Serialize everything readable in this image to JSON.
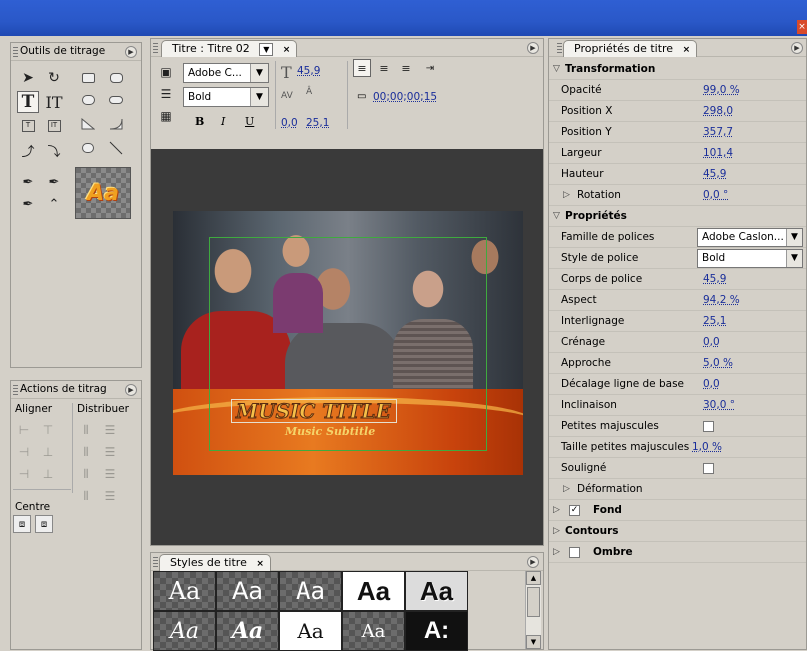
{
  "window": {
    "close_glyph": "×"
  },
  "tools_panel": {
    "title": "Outils de titrage",
    "sample_text": "Aa"
  },
  "actions_panel": {
    "title": "Actions de titrag",
    "align_label": "Aligner",
    "distribute_label": "Distribuer",
    "center_label": "Centre"
  },
  "title_panel": {
    "tab_label": "Titre : Titre 02",
    "font_family": "Adobe C...",
    "font_style": "Bold",
    "font_size": "45,9",
    "kerning": "0,0",
    "leading": "25,1",
    "timecode": "00;00;00;15",
    "bold_label": "B",
    "italic_label": "I",
    "underline_label": "U",
    "music_title": "MUSIC TITLE",
    "music_subtitle": "Music Subtitle"
  },
  "styles_panel": {
    "tab_label": "Styles de titre",
    "swatches": [
      "Aa",
      "Aa",
      "Aa",
      "Aa",
      "Aa",
      "Aa",
      "Aa",
      "Aa",
      "Aa",
      "A:"
    ]
  },
  "properties_panel": {
    "tab_label": "Propriétés de titre",
    "transformation_label": "Transformation",
    "opacity_label": "Opacité",
    "opacity": "99,0 %",
    "pos_x_label": "Position X",
    "pos_x": "298,0",
    "pos_y_label": "Position Y",
    "pos_y": "357,7",
    "width_label": "Largeur",
    "width": "101,4",
    "height_label": "Hauteur",
    "height": "45,9",
    "rotation_label": "Rotation",
    "rotation": "0,0 °",
    "properties_label": "Propriétés",
    "font_family_label": "Famille de polices",
    "font_family": "Adobe Caslon...",
    "font_style_label": "Style de police",
    "font_style": "Bold",
    "font_size_label": "Corps de police",
    "font_size": "45,9",
    "aspect_label": "Aspect",
    "aspect": "94,2 %",
    "leading_label": "Interlignage",
    "leading": "25,1",
    "kerning_label": "Crénage",
    "kerning": "0,0",
    "tracking_label": "Approche",
    "tracking": "5,0 %",
    "baseline_label": "Décalage ligne de base",
    "baseline": "0,0",
    "slant_label": "Inclinaison",
    "slant": "30,0 °",
    "smallcaps_label": "Petites majuscules",
    "smallcaps_size_label": "Taille petites majuscules",
    "smallcaps_size": "1,0 %",
    "underline_label": "Souligné",
    "distort_label": "Déformation",
    "fill_label": "Fond",
    "strokes_label": "Contours",
    "shadow_label": "Ombre"
  }
}
